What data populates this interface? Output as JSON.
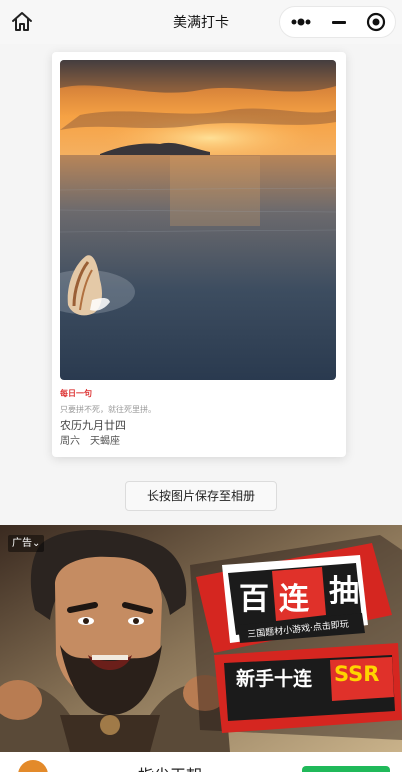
{
  "navbar": {
    "title": "美满打卡",
    "icons": [
      "home-icon",
      "more-dots-icon",
      "minimize-icon",
      "close-target-icon"
    ]
  },
  "card": {
    "daily_tag": "每日一句",
    "quote": "只要拼不死，就往死里拼。",
    "lunar_date": "农历九月廿四",
    "weekday_sign": "周六　天蝎座"
  },
  "actions": {
    "save_label": "长按图片保存至相册"
  },
  "ad": {
    "badge": "广告",
    "headline_1": "百",
    "headline_2": "连",
    "headline_3": "抽",
    "subline": "三国题材小游戏·点击即玩",
    "promo": "新手十连",
    "promo_tier": "SSR"
  },
  "bottom": {
    "title": "指尖王朝"
  },
  "colors": {
    "accent_red": "#e0312a",
    "promo_yellow": "#ffd400",
    "action_green": "#20b95a"
  }
}
